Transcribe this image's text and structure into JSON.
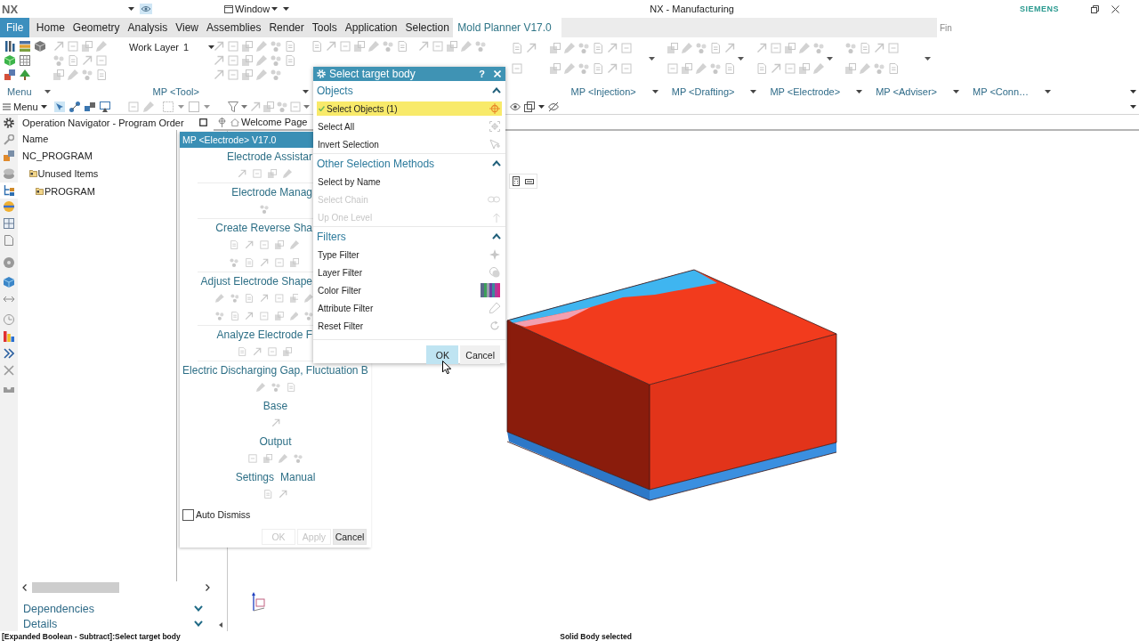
{
  "title_bar": {
    "app": "NX",
    "window_menu": "Window",
    "title": "NX - Manufacturing",
    "brand": "SIEMENS"
  },
  "menu_bar": {
    "tabs": [
      {
        "label": "File",
        "kind": "file",
        "selected": false
      },
      {
        "label": "Home",
        "kind": "tab",
        "selected": false
      },
      {
        "label": "Geometry",
        "kind": "tab",
        "selected": false
      },
      {
        "label": "Analysis",
        "kind": "tab",
        "selected": false
      },
      {
        "label": "View",
        "kind": "tab",
        "selected": false
      },
      {
        "label": "Assemblies",
        "kind": "tab",
        "selected": false
      },
      {
        "label": "Render",
        "kind": "tab",
        "selected": false
      },
      {
        "label": "Tools",
        "kind": "tab",
        "selected": false
      },
      {
        "label": "Application",
        "kind": "tab",
        "selected": false
      },
      {
        "label": "Selection",
        "kind": "tab",
        "selected": false
      },
      {
        "label": "Mold Planner V17.0",
        "kind": "tab",
        "selected": true
      }
    ],
    "search": {
      "placeholder": "Fin"
    }
  },
  "ribbon": {
    "work_layer": {
      "label": "Work Layer",
      "value": "1"
    }
  },
  "group_bar": {
    "menu": "Menu",
    "groups": [
      "MP <Tool>",
      "MP <Injection>",
      "MP <Drafting>",
      "MP <Electrode>",
      "MP <Adviser>",
      "MP <Conn…"
    ]
  },
  "toolbar": {
    "menu": "Menu"
  },
  "resource_bar": {
    "tabs": [
      {
        "selected": false
      },
      {
        "selected": false
      },
      {
        "selected": false
      },
      {
        "selected": false
      },
      {
        "selected": true
      },
      {
        "selected": false
      },
      {
        "selected": false
      },
      {
        "selected": false
      },
      {
        "selected": false
      },
      {
        "selected": false
      },
      {
        "selected": false
      },
      {
        "selected": false
      },
      {
        "selected": false
      },
      {
        "selected": false
      },
      {
        "selected": false
      },
      {
        "selected": false
      }
    ]
  },
  "navigator": {
    "title": "Operation Navigator - Program Order",
    "column": "Name",
    "tree": [
      {
        "label": "NC_PROGRAM",
        "kind": "root",
        "children": [
          {
            "label": "Unused Items",
            "kind": "folder",
            "children": [
              {
                "label": "PROGRAM",
                "kind": "folder"
              }
            ]
          }
        ]
      }
    ],
    "panels": [
      {
        "label": "Dependencies",
        "expanded": false
      },
      {
        "label": "Details",
        "expanded": false
      }
    ]
  },
  "graphics": {
    "tabs": [
      {
        "label": "Welcome Page",
        "selected": false
      }
    ]
  },
  "electrode_panel": {
    "title": "MP <Electrode> V17.0",
    "sections": [
      {
        "titles": [
          "Electrode Assistar"
        ]
      },
      {
        "titles": [
          "Electrode Manag"
        ]
      },
      {
        "titles": [
          "Create Reverse Sha"
        ]
      },
      {
        "titles": [
          "Adjust Electrode Shape"
        ]
      },
      {
        "titles": [
          "Analyze Electrode F"
        ]
      },
      {
        "titles": [
          "Electric Discharging Gap, Fluctuation B"
        ]
      },
      {
        "titles": [
          "Base"
        ]
      },
      {
        "titles": [
          "Output"
        ]
      },
      {
        "titles": [
          "Settings",
          "Manual"
        ]
      }
    ],
    "auto_dismiss": {
      "label": "Auto Dismiss",
      "checked": false
    },
    "buttons": [
      {
        "label": "OK",
        "disabled": true
      },
      {
        "label": "Apply",
        "disabled": true
      },
      {
        "label": "Cancel",
        "disabled": false
      }
    ]
  },
  "dialog": {
    "title": "Select target body",
    "help": "?",
    "groups": [
      {
        "title": "Objects",
        "expanded": true,
        "rows": [
          {
            "label": "Select Objects (1)",
            "selected": true,
            "disabled": false
          },
          {
            "label": "Select All",
            "selected": false,
            "disabled": false
          },
          {
            "label": "Invert Selection",
            "selected": false,
            "disabled": false
          }
        ]
      },
      {
        "title": "Other Selection Methods",
        "expanded": true,
        "rows": [
          {
            "label": "Select by Name",
            "selected": false,
            "disabled": false
          },
          {
            "label": "Select Chain",
            "selected": false,
            "disabled": true
          },
          {
            "label": "Up One Level",
            "selected": false,
            "disabled": true
          }
        ]
      },
      {
        "title": "Filters",
        "expanded": true,
        "rows": [
          {
            "label": "Type Filter",
            "selected": false,
            "disabled": false
          },
          {
            "label": "Layer Filter",
            "selected": false,
            "disabled": false
          },
          {
            "label": "Color Filter",
            "selected": false,
            "disabled": false
          },
          {
            "label": "Attribute Filter",
            "selected": false,
            "disabled": false
          },
          {
            "label": "Reset Filter",
            "selected": false,
            "disabled": false
          }
        ]
      }
    ],
    "buttons": [
      {
        "label": "OK",
        "highlighted": true
      },
      {
        "label": "Cancel",
        "highlighted": false
      }
    ]
  },
  "status_bar": {
    "prompt": "[Expanded Boolean - Subtract]:Select target body",
    "message": "Solid Body selected"
  }
}
